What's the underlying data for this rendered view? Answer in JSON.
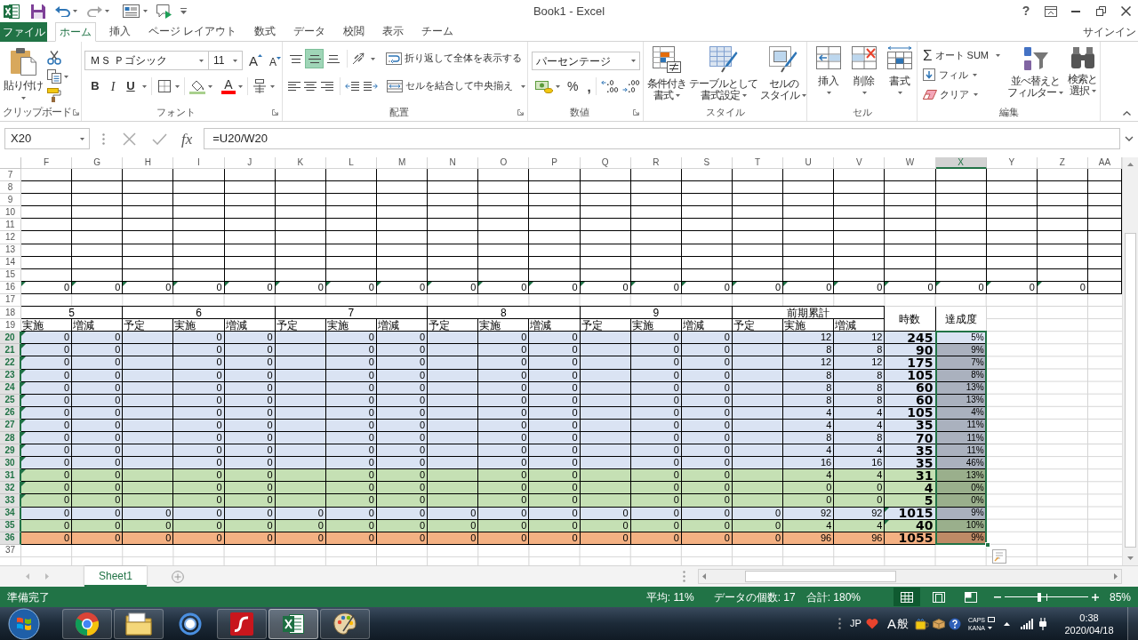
{
  "title_bar": {
    "title": "Book1 - Excel",
    "help": "?"
  },
  "ribbon": {
    "file_tab": "ファイル",
    "tabs": [
      {
        "label": "ホーム",
        "selected": true
      },
      {
        "label": "挿入",
        "selected": false
      },
      {
        "label": "ページ レイアウト",
        "selected": false
      },
      {
        "label": "数式",
        "selected": false
      },
      {
        "label": "データ",
        "selected": false
      },
      {
        "label": "校閲",
        "selected": false
      },
      {
        "label": "表示",
        "selected": false
      },
      {
        "label": "チーム",
        "selected": false
      }
    ],
    "sign_in": "サインイン",
    "clipboard": {
      "paste": "貼り付け",
      "label": "クリップボード"
    },
    "font": {
      "name": "ＭＳ Ｐゴシック",
      "size": "11",
      "grow_font": "A",
      "shrink_font": "A",
      "bold": "B",
      "italic": "I",
      "underline": "U",
      "font_color": "A",
      "label": "フォント"
    },
    "alignment": {
      "vertical": [
        {
          "kind": "top",
          "selected": false
        },
        {
          "kind": "middle",
          "selected": true
        },
        {
          "kind": "bottom",
          "selected": false
        }
      ],
      "wrap_text": "折り返して全体を表示する",
      "merge": "セルを結合して中央揃え",
      "label": "配置"
    },
    "number": {
      "format": "パーセンテージ",
      "percent": "%",
      "comma": ",",
      "label": "数値"
    },
    "styles": {
      "buttons": [
        {
          "kind": "conditional",
          "lines": [
            "条件付き",
            "書式"
          ]
        },
        {
          "kind": "table",
          "lines": [
            "テーブルとして",
            "書式設定"
          ]
        },
        {
          "kind": "cell",
          "lines": [
            "セルの",
            "スタイル"
          ]
        }
      ],
      "label": "スタイル"
    },
    "cells": {
      "buttons": [
        {
          "kind": "insert",
          "label": "挿入"
        },
        {
          "kind": "delete",
          "label": "削除"
        },
        {
          "kind": "format",
          "label": "書式"
        }
      ],
      "label": "セル"
    },
    "editing": {
      "autosum_symbol": "Σ",
      "autosum": "オート SUM",
      "fill": "フィル",
      "clear": "クリア",
      "buttons": [
        {
          "kind": "sort",
          "lines": [
            "並べ替えと",
            "フィルター"
          ]
        },
        {
          "kind": "find",
          "lines": [
            "検索と",
            "選択"
          ]
        }
      ],
      "label": "編集"
    }
  },
  "formula_bar": {
    "name_box": "X20",
    "function_symbol": "fx",
    "formula": "=U20/W20"
  },
  "sheet": {
    "columns": [
      {
        "label": "F",
        "selected": false
      },
      {
        "label": "G",
        "selected": false
      },
      {
        "label": "H",
        "selected": false
      },
      {
        "label": "I",
        "selected": false
      },
      {
        "label": "J",
        "selected": false
      },
      {
        "label": "K",
        "selected": false
      },
      {
        "label": "L",
        "selected": false
      },
      {
        "label": "M",
        "selected": false
      },
      {
        "label": "N",
        "selected": false
      },
      {
        "label": "O",
        "selected": false
      },
      {
        "label": "P",
        "selected": false
      },
      {
        "label": "Q",
        "selected": false
      },
      {
        "label": "R",
        "selected": false
      },
      {
        "label": "S",
        "selected": false
      },
      {
        "label": "T",
        "selected": false
      },
      {
        "label": "U",
        "selected": false
      },
      {
        "label": "V",
        "selected": false
      },
      {
        "label": "W",
        "selected": false
      },
      {
        "label": "X",
        "selected": true
      },
      {
        "label": "Y",
        "selected": false
      },
      {
        "label": "Z",
        "selected": false
      },
      {
        "label": "AA",
        "selected": false
      }
    ],
    "table_header": {
      "groups": [
        {
          "label": "5",
          "columns": [
            "実施",
            "増減"
          ]
        },
        {
          "label": "6",
          "columns": [
            "予定",
            "実施",
            "増減"
          ]
        },
        {
          "label": "7",
          "columns": [
            "予定",
            "実施",
            "増減"
          ]
        },
        {
          "label": "8",
          "columns": [
            "予定",
            "実施",
            "増減"
          ]
        },
        {
          "label": "9",
          "columns": [
            "予定",
            "実施",
            "増減"
          ]
        },
        {
          "label": "前期累計",
          "columns": [
            "予定",
            "実施",
            "増減"
          ]
        }
      ],
      "hours": "時数",
      "rate": "達成度"
    },
    "rows": [
      {
        "label": "7",
        "selected": false,
        "kind": "ruled"
      },
      {
        "label": "8",
        "selected": false,
        "kind": "ruled"
      },
      {
        "label": "9",
        "selected": false,
        "kind": "ruled"
      },
      {
        "label": "10",
        "selected": false,
        "kind": "ruled"
      },
      {
        "label": "11",
        "selected": false,
        "kind": "ruled"
      },
      {
        "label": "12",
        "selected": false,
        "kind": "ruled"
      },
      {
        "label": "13",
        "selected": false,
        "kind": "ruled"
      },
      {
        "label": "14",
        "selected": false,
        "kind": "ruled"
      },
      {
        "label": "15",
        "selected": false,
        "kind": "ruled"
      },
      {
        "label": "16",
        "selected": false,
        "kind": "totals",
        "flagged": true,
        "cells": [
          "0",
          "0",
          "0",
          "0",
          "0",
          "0",
          "0",
          "0",
          "0",
          "0",
          "0",
          "0",
          "0",
          "0",
          "0",
          "0",
          "0",
          "0",
          "0",
          "0",
          "0"
        ]
      },
      {
        "label": "17",
        "selected": false,
        "kind": "blank"
      },
      {
        "label": "18",
        "selected": false,
        "kind": "header"
      },
      {
        "label": "19",
        "selected": false,
        "kind": "header"
      },
      {
        "label": "20",
        "selected": true,
        "kind": "data",
        "color": "#dae3f3",
        "flag_first": true,
        "cells": [
          "0",
          "0",
          null,
          "0",
          "0",
          null,
          "0",
          "0",
          null,
          "0",
          "0",
          null,
          "0",
          "0",
          null,
          "12",
          "12"
        ],
        "hours": "245",
        "flag_hours": false,
        "rate": "5%",
        "active": true
      },
      {
        "label": "21",
        "selected": true,
        "kind": "data",
        "color": "#dae3f3",
        "flag_first": true,
        "cells": [
          "0",
          "0",
          null,
          "0",
          "0",
          null,
          "0",
          "0",
          null,
          "0",
          "0",
          null,
          "0",
          "0",
          null,
          "8",
          "8"
        ],
        "hours": "90",
        "flag_hours": false,
        "rate": "9%",
        "active": false
      },
      {
        "label": "22",
        "selected": true,
        "kind": "data",
        "color": "#dae3f3",
        "flag_first": true,
        "cells": [
          "0",
          "0",
          null,
          "0",
          "0",
          null,
          "0",
          "0",
          null,
          "0",
          "0",
          null,
          "0",
          "0",
          null,
          "12",
          "12"
        ],
        "hours": "175",
        "flag_hours": false,
        "rate": "7%",
        "active": false
      },
      {
        "label": "23",
        "selected": true,
        "kind": "data",
        "color": "#dae3f3",
        "flag_first": true,
        "cells": [
          "0",
          "0",
          null,
          "0",
          "0",
          null,
          "0",
          "0",
          null,
          "0",
          "0",
          null,
          "0",
          "0",
          null,
          "8",
          "8"
        ],
        "hours": "105",
        "flag_hours": false,
        "rate": "8%",
        "active": false
      },
      {
        "label": "24",
        "selected": true,
        "kind": "data",
        "color": "#dae3f3",
        "flag_first": true,
        "cells": [
          "0",
          "0",
          null,
          "0",
          "0",
          null,
          "0",
          "0",
          null,
          "0",
          "0",
          null,
          "0",
          "0",
          null,
          "8",
          "8"
        ],
        "hours": "60",
        "flag_hours": false,
        "rate": "13%",
        "active": false
      },
      {
        "label": "25",
        "selected": true,
        "kind": "data",
        "color": "#dae3f3",
        "flag_first": true,
        "cells": [
          "0",
          "0",
          null,
          "0",
          "0",
          null,
          "0",
          "0",
          null,
          "0",
          "0",
          null,
          "0",
          "0",
          null,
          "8",
          "8"
        ],
        "hours": "60",
        "flag_hours": false,
        "rate": "13%",
        "active": false
      },
      {
        "label": "26",
        "selected": true,
        "kind": "data",
        "color": "#dae3f3",
        "flag_first": true,
        "cells": [
          "0",
          "0",
          null,
          "0",
          "0",
          null,
          "0",
          "0",
          null,
          "0",
          "0",
          null,
          "0",
          "0",
          null,
          "4",
          "4"
        ],
        "hours": "105",
        "flag_hours": false,
        "rate": "4%",
        "active": false
      },
      {
        "label": "27",
        "selected": true,
        "kind": "data",
        "color": "#dae3f3",
        "flag_first": true,
        "cells": [
          "0",
          "0",
          null,
          "0",
          "0",
          null,
          "0",
          "0",
          null,
          "0",
          "0",
          null,
          "0",
          "0",
          null,
          "4",
          "4"
        ],
        "hours": "35",
        "flag_hours": false,
        "rate": "11%",
        "active": false
      },
      {
        "label": "28",
        "selected": true,
        "kind": "data",
        "color": "#dae3f3",
        "flag_first": true,
        "cells": [
          "0",
          "0",
          null,
          "0",
          "0",
          null,
          "0",
          "0",
          null,
          "0",
          "0",
          null,
          "0",
          "0",
          null,
          "8",
          "8"
        ],
        "hours": "70",
        "flag_hours": false,
        "rate": "11%",
        "active": false
      },
      {
        "label": "29",
        "selected": true,
        "kind": "data",
        "color": "#dae3f3",
        "flag_first": true,
        "cells": [
          "0",
          "0",
          null,
          "0",
          "0",
          null,
          "0",
          "0",
          null,
          "0",
          "0",
          null,
          "0",
          "0",
          null,
          "4",
          "4"
        ],
        "hours": "35",
        "flag_hours": false,
        "rate": "11%",
        "active": false
      },
      {
        "label": "30",
        "selected": true,
        "kind": "data",
        "color": "#dae3f3",
        "flag_first": true,
        "cells": [
          "0",
          "0",
          null,
          "0",
          "0",
          null,
          "0",
          "0",
          null,
          "0",
          "0",
          null,
          "0",
          "0",
          null,
          "16",
          "16"
        ],
        "hours": "35",
        "flag_hours": false,
        "rate": "46%",
        "active": false
      },
      {
        "label": "31",
        "selected": true,
        "kind": "data",
        "color": "#c5e0b4",
        "flag_first": true,
        "cells": [
          "0",
          "0",
          null,
          "0",
          "0",
          null,
          "0",
          "0",
          null,
          "0",
          "0",
          null,
          "0",
          "0",
          null,
          "4",
          "4"
        ],
        "hours": "31",
        "flag_hours": false,
        "rate": "13%",
        "active": false
      },
      {
        "label": "32",
        "selected": true,
        "kind": "data",
        "color": "#c5e0b4",
        "flag_first": true,
        "cells": [
          "0",
          "0",
          null,
          "0",
          "0",
          null,
          "0",
          "0",
          null,
          "0",
          "0",
          null,
          "0",
          "0",
          null,
          "0",
          "0"
        ],
        "hours": "4",
        "flag_hours": false,
        "rate": "0%",
        "active": false
      },
      {
        "label": "33",
        "selected": true,
        "kind": "data",
        "color": "#c5e0b4",
        "flag_first": true,
        "cells": [
          "0",
          "0",
          null,
          "0",
          "0",
          null,
          "0",
          "0",
          null,
          "0",
          "0",
          null,
          "0",
          "0",
          null,
          "0",
          "0"
        ],
        "hours": "5",
        "flag_hours": false,
        "rate": "0%",
        "active": false
      },
      {
        "label": "34",
        "selected": true,
        "kind": "data",
        "color": "#dae3f3",
        "flag_first": false,
        "cells": [
          "0",
          "0",
          "0",
          "0",
          "0",
          "0",
          "0",
          "0",
          "0",
          "0",
          "0",
          "0",
          "0",
          "0",
          "0",
          "92",
          "92"
        ],
        "hours": "1015",
        "flag_hours": true,
        "rate": "9%",
        "active": false
      },
      {
        "label": "35",
        "selected": true,
        "kind": "data",
        "color": "#c5e0b4",
        "flag_first": false,
        "cells": [
          "0",
          "0",
          "0",
          "0",
          "0",
          "0",
          "0",
          "0",
          "0",
          "0",
          "0",
          "0",
          "0",
          "0",
          "0",
          "4",
          "4"
        ],
        "hours": "40",
        "flag_hours": true,
        "rate": "10%",
        "active": false
      },
      {
        "label": "36",
        "selected": true,
        "kind": "data",
        "color": "#f4b183",
        "flag_first": false,
        "cells": [
          "0",
          "0",
          "0",
          "0",
          "0",
          "0",
          "0",
          "0",
          "0",
          "0",
          "0",
          "0",
          "0",
          "0",
          "0",
          "96",
          "96"
        ],
        "hours": "1055",
        "flag_hours": false,
        "rate": "9%",
        "active": false
      },
      {
        "label": "37",
        "selected": false,
        "kind": "blank"
      }
    ]
  },
  "sheet_tabs": [
    {
      "label": "Sheet1",
      "selected": true
    }
  ],
  "status_bar": {
    "status": "準備完了",
    "average": "平均: 11%",
    "count": "データの個数: 17",
    "sum": "合計: 180%",
    "views": [
      {
        "kind": "normal",
        "selected": true
      },
      {
        "kind": "page_layout",
        "selected": false
      },
      {
        "kind": "page_break",
        "selected": false
      }
    ],
    "zoom": {
      "level": 0.42,
      "reading": "85%"
    }
  },
  "taskbar": {
    "apps": [
      {
        "kind": "browser",
        "running": true,
        "selected": false
      },
      {
        "kind": "folder",
        "running": true,
        "selected": false
      },
      {
        "kind": "ring",
        "running": false,
        "selected": false
      },
      {
        "kind": "flash",
        "running": true,
        "selected": false
      },
      {
        "kind": "sheet",
        "running": true,
        "selected": true
      },
      {
        "kind": "paint",
        "running": true,
        "selected": false
      }
    ],
    "tray": {
      "language": "JP",
      "ime_mode": "A",
      "ime_dict": "般",
      "caps": "CAPS",
      "kana": "KANA",
      "time": "0:38",
      "date": "2020/04/18"
    }
  }
}
